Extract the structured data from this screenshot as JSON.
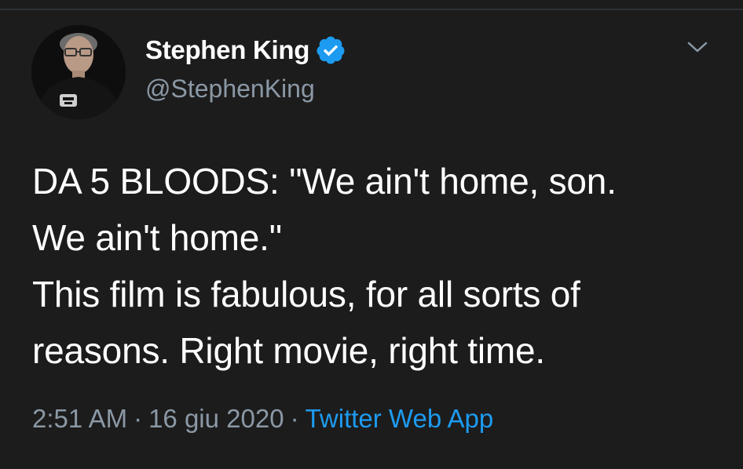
{
  "author": {
    "display_name": "Stephen King",
    "handle": "@StephenKing",
    "verified": true,
    "avatar": "avatar-photo"
  },
  "tweet": {
    "lines": [
      "DA 5 BLOODS: \"We ain't home, son.",
      "We ain't home.\"",
      "This film is fabulous, for all sorts of",
      "reasons. Right movie, right time."
    ]
  },
  "meta": {
    "time": "2:51 AM",
    "separator": "·",
    "date": "16 giu 2020",
    "source": "Twitter Web App"
  },
  "icons": {
    "verified": "verified-badge-icon",
    "menu": "chevron-down-icon"
  },
  "colors": {
    "background": "#1c1c1c",
    "text": "#ffffff",
    "muted": "#8b98a5",
    "link": "#1d9bf0",
    "verified": "#1d9bf0"
  }
}
